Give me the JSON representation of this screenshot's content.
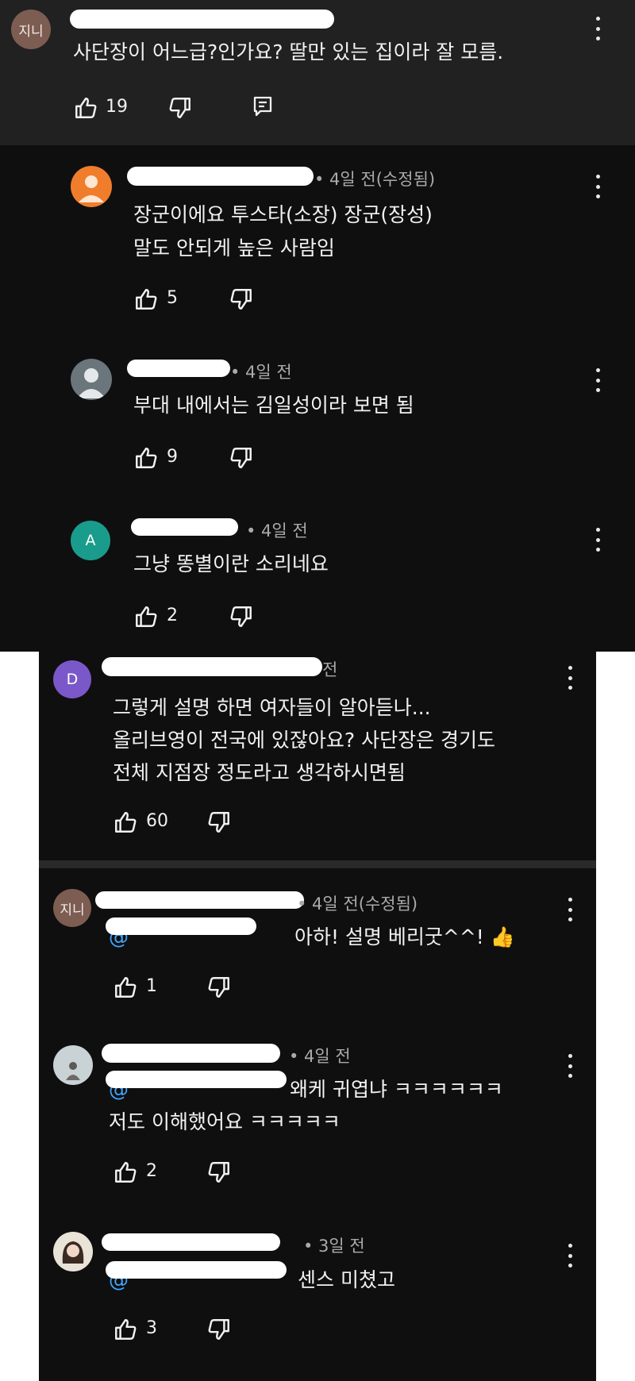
{
  "top_comment": {
    "avatar_text": "지니",
    "text": "사단장이 어느급?인가요? 딸만 있는 집이라 잘 모름.",
    "likes": "19"
  },
  "replies": [
    {
      "time": "• 4일 전(수정됨)",
      "lines": [
        "장군이에요 투스타(소장) 장군(장성)",
        "말도 안되게 높은 사람임"
      ],
      "likes": "5"
    },
    {
      "time": "• 4일 전",
      "lines": [
        "부대 내에서는  김일성이라 보면 됨"
      ],
      "likes": "9"
    },
    {
      "avatar_text": "A",
      "time": "• 4일 전",
      "lines": [
        "그냥 똥별이란 소리네요"
      ],
      "likes": "2"
    },
    {
      "avatar_text": "D",
      "time": "전",
      "lines": [
        "그렇게 설명 하면 여자들이 알아듣나...",
        "올리브영이 전국에 있잖아요? 사단장은 경기도",
        "전체 지점장 정도라고 생각하시면됨"
      ],
      "likes": "60"
    },
    {
      "avatar_text": "지니",
      "time": "• 4일 전(수정됨)",
      "mention": "@",
      "lines": [
        "아하! 설명 베리굿^^! 👍"
      ],
      "likes": "1"
    },
    {
      "time": "• 4일 전",
      "mention": "@",
      "lines": [
        "왜케 귀엽냐 ㅋㅋㅋㅋㅋㅋ",
        "저도 이해했어요 ㅋㅋㅋㅋㅋ"
      ],
      "likes": "2"
    },
    {
      "time": "• 3일 전",
      "mention": "@",
      "lines": [
        "센스 미쳤고"
      ],
      "likes": "3"
    }
  ],
  "colors": {
    "top_background": "#212121",
    "reply_background": "#0f0f0f",
    "mention": "#3ea6ff",
    "avatar_orange": "#f07d2c",
    "avatar_teal": "#1a9c8c",
    "avatar_purple": "#7b58c9",
    "avatar_jini": "#7d5c52"
  },
  "icons": [
    "thumbs-up-icon",
    "thumbs-down-icon",
    "reply-icon",
    "more-vert-icon",
    "person-icon"
  ]
}
